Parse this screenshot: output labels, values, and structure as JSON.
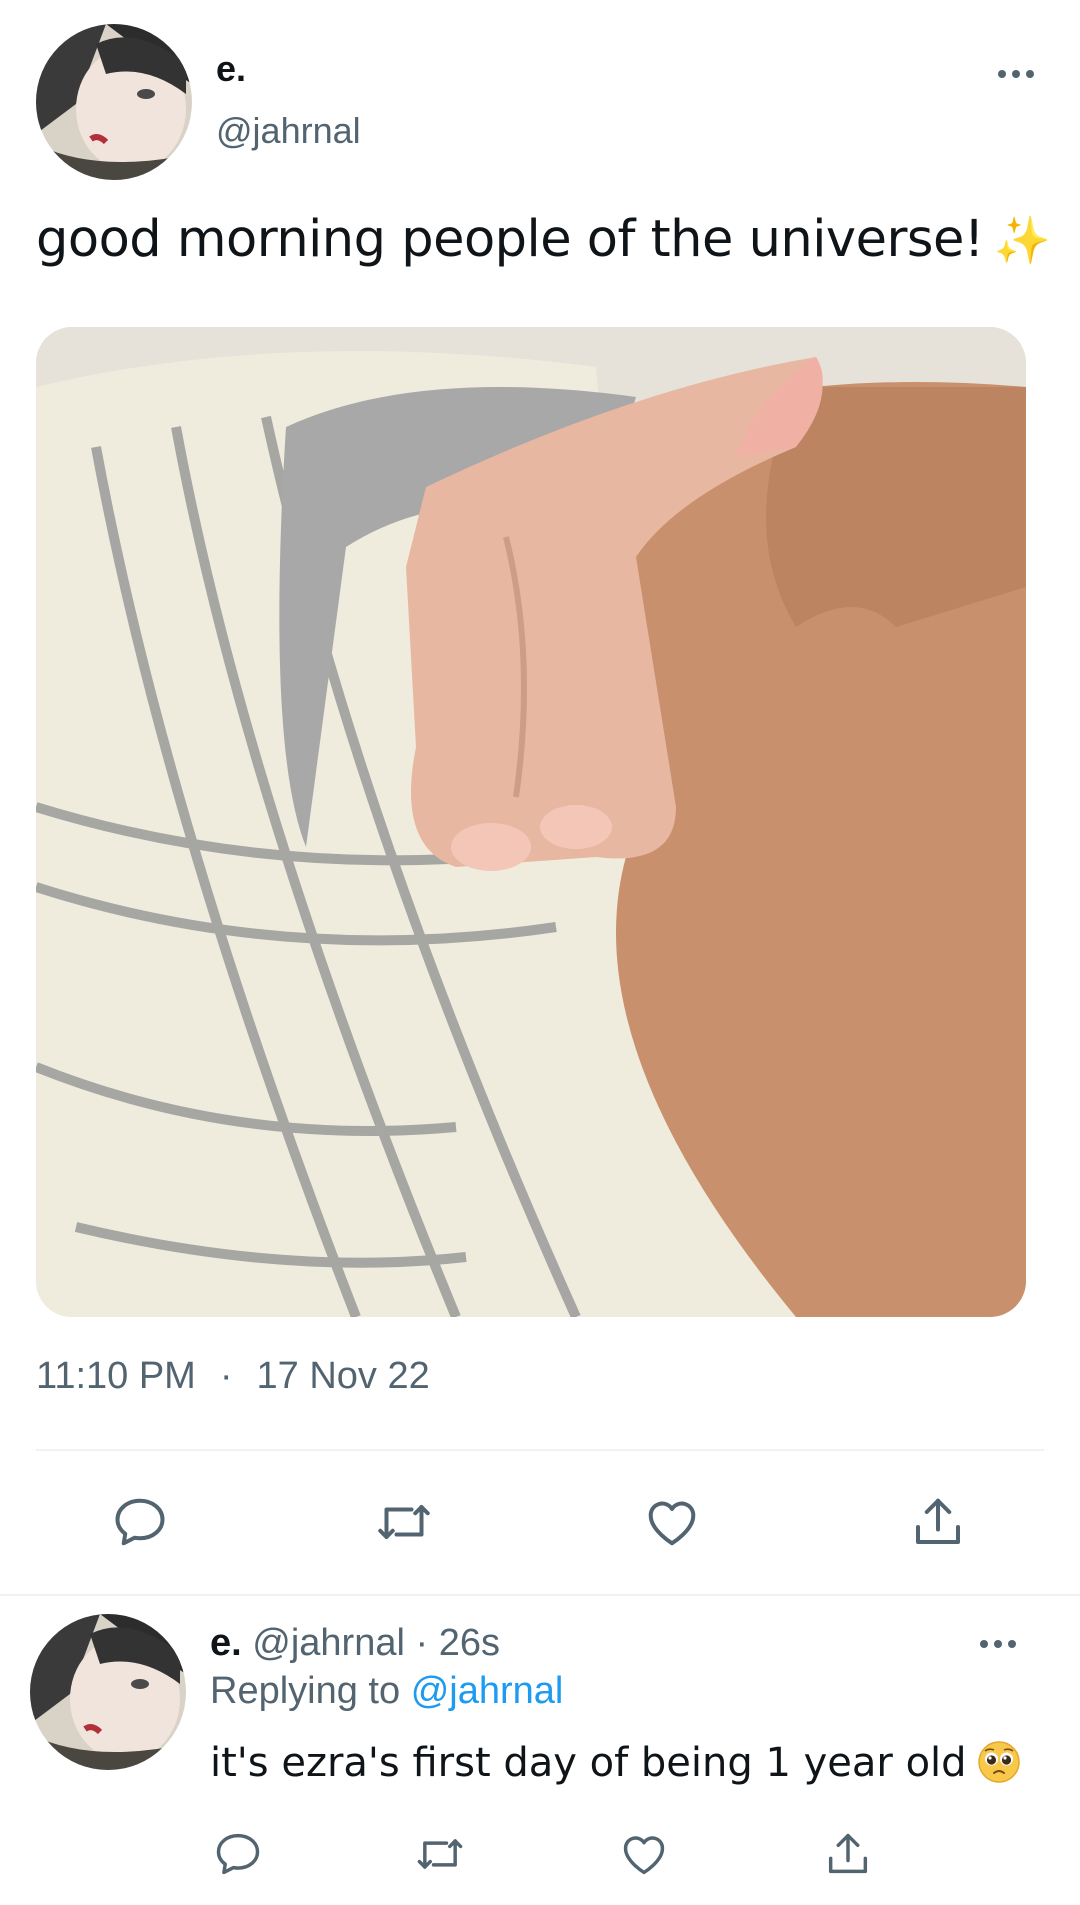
{
  "main_tweet": {
    "author_name": "e.",
    "author_handle": "@jahrnal",
    "text": "good morning people of the universe!",
    "emoji": "✨",
    "time": "11:10 PM",
    "separator": "·",
    "date": "17 Nov 22"
  },
  "reply_tweet": {
    "author_name": "e.",
    "author_handle": "@jahrnal",
    "separator": "·",
    "age": "26s",
    "replying_label": "Replying to",
    "replying_to": "@jahrnal",
    "text": "it's ezra's first day of being 1 year old"
  },
  "icons": {
    "more": "more-horizontal-icon",
    "reply": "reply-icon",
    "retweet": "retweet-icon",
    "like": "heart-icon",
    "share": "share-icon",
    "reply_emoji": "pleading-face-emoji"
  },
  "colors": {
    "text_primary": "#0f1419",
    "text_secondary": "#536471",
    "link": "#1d9bf0",
    "divider": "#eff3f4"
  }
}
